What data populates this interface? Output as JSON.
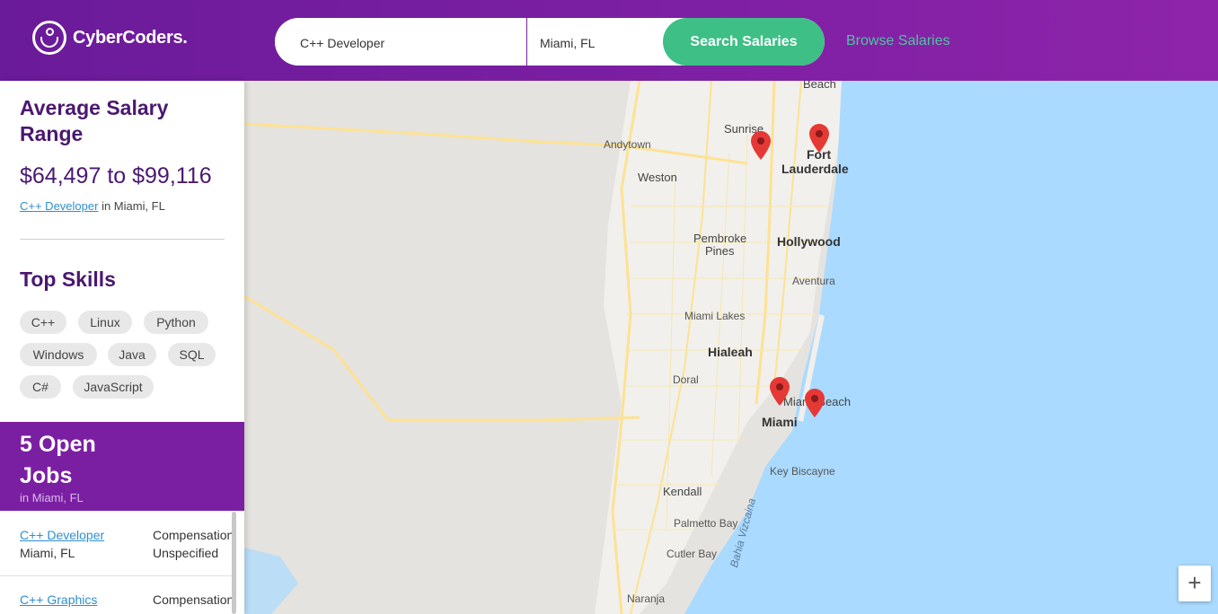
{
  "header": {
    "logo_text": "CyberCoders.",
    "search": {
      "job_value": "C++ Developer",
      "location_value": "Miami, FL",
      "button_label": "Search Salaries"
    },
    "browse_label": "Browse Salaries"
  },
  "salary": {
    "title": "Average Salary Range",
    "range": "$64,497 to $99,116",
    "job_link": "C++ Developer",
    "location_text": " in Miami, FL"
  },
  "skills": {
    "title": "Top Skills",
    "items": [
      "C++",
      "Linux",
      "Python",
      "Windows",
      "Java",
      "SQL",
      "C#",
      "JavaScript"
    ]
  },
  "jobs": {
    "count_title": "5 Open Jobs",
    "location": "in Miami, FL",
    "list": [
      {
        "title": "C++ Developer",
        "location": "Miami, FL",
        "comp_label": "Compensation",
        "comp_value": "Unspecified"
      },
      {
        "title": "C++ Graphics",
        "location": "",
        "comp_label": "Compensation",
        "comp_value": ""
      }
    ]
  },
  "map": {
    "labels": {
      "beach": "Beach",
      "sunrise": "Sunrise",
      "fort1": "Fort",
      "fort2": "Lauderdale",
      "andytown": "Andytown",
      "weston": "Weston",
      "pembroke1": "Pembroke",
      "pembroke2": "Pines",
      "hollywood": "Hollywood",
      "aventura": "Aventura",
      "miami_lakes": "Miami Lakes",
      "hialeah": "Hialeah",
      "doral": "Doral",
      "miami": "Miami",
      "miami_beach": "Miami Beach",
      "key_biscayne": "Key Biscayne",
      "kendall": "Kendall",
      "palmetto_bay": "Palmetto Bay",
      "cutler_bay": "Cutler Bay",
      "bahia": "Bahia Vizcaina",
      "naranja": "Naranja"
    },
    "zoom_in": "+",
    "colors": {
      "water": "#aadaff",
      "land": "#e5e3df",
      "urban": "#f1f0ec",
      "road": "#fde293",
      "pin": "#e53935"
    }
  }
}
